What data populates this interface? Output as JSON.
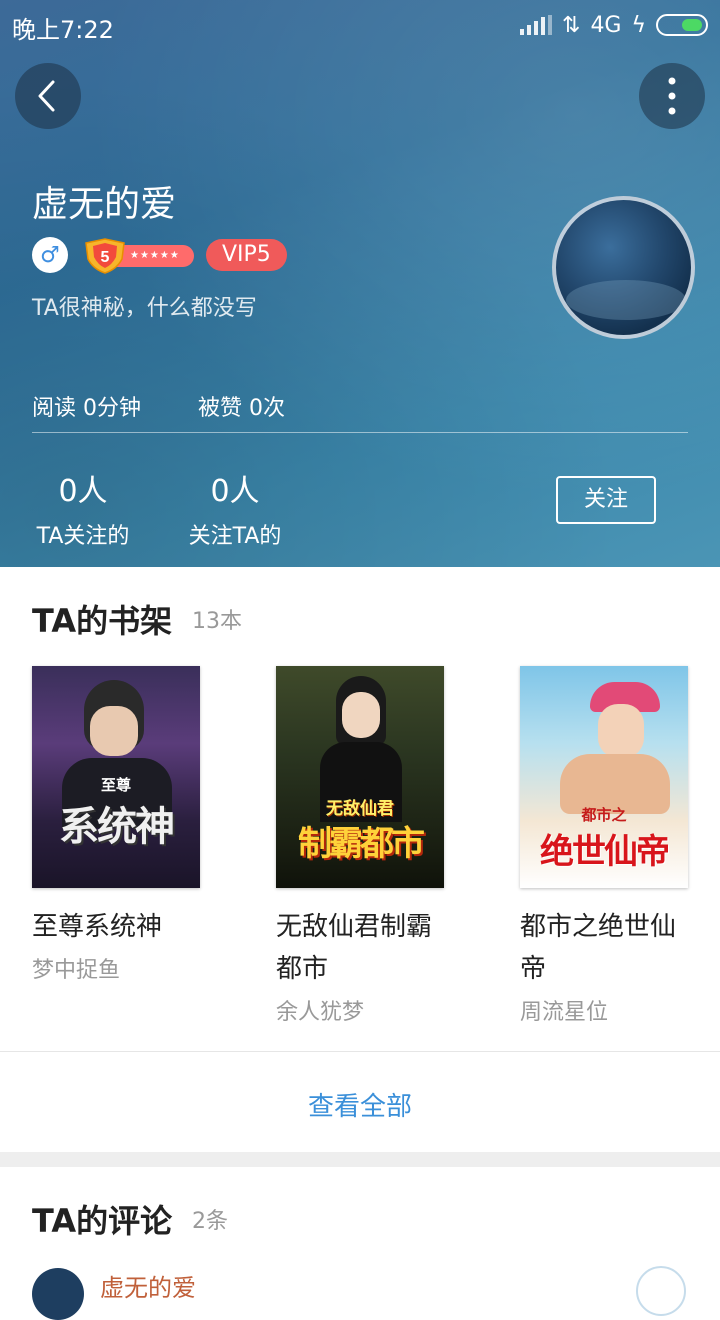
{
  "status_bar": {
    "time": "晚上7:22",
    "network": "4G"
  },
  "profile": {
    "name": "虚无的爱",
    "gender_symbol": "♂",
    "level": "5",
    "vip": "VIP5",
    "bio": "TA很神秘，什么都没写",
    "read_time": "阅读  0分钟",
    "likes": "被赞  0次",
    "following_count": "0人",
    "following_label": "TA关注的",
    "followers_count": "0人",
    "followers_label": "关注TA的",
    "follow_button": "关注"
  },
  "bookshelf": {
    "title": "TA的书架",
    "count": "13本",
    "view_all": "查看全部",
    "books": [
      {
        "title": "至尊系统神",
        "author": "梦中捉鱼",
        "cover_text": "系统神",
        "cover_sub": "至尊"
      },
      {
        "title": "无敌仙君制霸都市",
        "author": "余人犹梦",
        "cover_text": "制霸都市",
        "cover_sub": "无敌仙君"
      },
      {
        "title": "都市之绝世仙帝",
        "author": "周流星位",
        "cover_text": "绝世仙帝",
        "cover_sub": "都市之"
      }
    ]
  },
  "comments": {
    "title": "TA的评论",
    "count": "2条",
    "first_author": "虚无的爱"
  },
  "colors": {
    "accent": "#3a8fd9",
    "vip": "#f05a5a",
    "header_blue": "#2f6f9a"
  }
}
